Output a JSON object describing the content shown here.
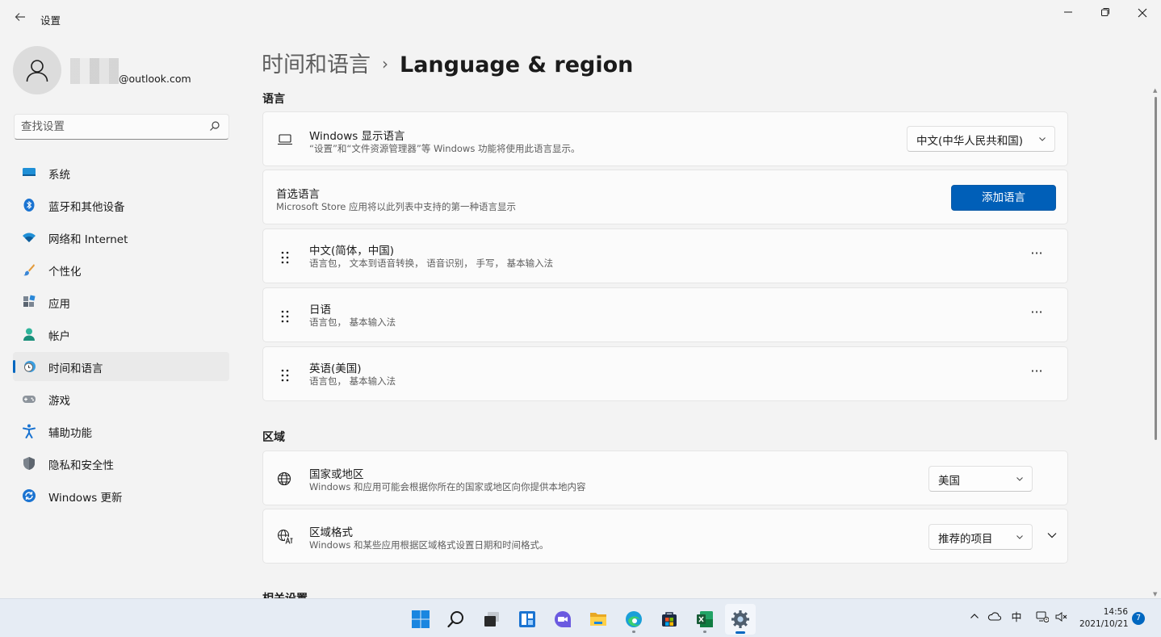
{
  "window": {
    "app_title": "设置"
  },
  "user": {
    "email_suffix": "@outlook.com"
  },
  "search": {
    "placeholder": "查找设置"
  },
  "nav": {
    "items": [
      {
        "label": "系统",
        "icon": "system-icon"
      },
      {
        "label": "蓝牙和其他设备",
        "icon": "bluetooth-icon"
      },
      {
        "label": "网络和 Internet",
        "icon": "wifi-icon"
      },
      {
        "label": "个性化",
        "icon": "brush-icon"
      },
      {
        "label": "应用",
        "icon": "apps-icon"
      },
      {
        "label": "帐户",
        "icon": "account-icon"
      },
      {
        "label": "时间和语言",
        "icon": "time-language-icon",
        "selected": true
      },
      {
        "label": "游戏",
        "icon": "gamepad-icon"
      },
      {
        "label": "辅助功能",
        "icon": "accessibility-icon"
      },
      {
        "label": "隐私和安全性",
        "icon": "shield-icon"
      },
      {
        "label": "Windows 更新",
        "icon": "update-icon"
      }
    ]
  },
  "breadcrumb": {
    "parent": "时间和语言",
    "separator": "›",
    "current": "Language & region"
  },
  "language_section": {
    "title": "语言",
    "display_language": {
      "title": "Windows 显示语言",
      "subtitle": "“设置”和“文件资源管理器”等 Windows 功能将使用此语言显示。",
      "value": "中文(中华人民共和国)"
    },
    "preferred": {
      "title": "首选语言",
      "subtitle": "Microsoft Store 应用将以此列表中支持的第一种语言显示",
      "button": "添加语言"
    },
    "languages": [
      {
        "name": "中文(简体，中国)",
        "features": "语言包， 文本到语音转换， 语音识别， 手写， 基本输入法"
      },
      {
        "name": "日语",
        "features": "语言包， 基本输入法"
      },
      {
        "name": "英语(美国)",
        "features": "语言包， 基本输入法"
      }
    ],
    "more_glyph": "···"
  },
  "region_section": {
    "title": "区域",
    "country": {
      "title": "国家或地区",
      "subtitle": "Windows 和应用可能会根据你所在的国家或地区向你提供本地内容",
      "value": "美国"
    },
    "format": {
      "title": "区域格式",
      "subtitle": "Windows 和某些应用根据区域格式设置日期和时间格式。",
      "value": "推荐的项目"
    }
  },
  "related_section": {
    "title": "相关设置"
  },
  "taskbar": {
    "apps": [
      "start-icon",
      "search-icon",
      "task-view-icon",
      "widgets-icon",
      "chat-icon",
      "file-explorer-icon",
      "edge-icon",
      "store-icon",
      "excel-icon",
      "settings-icon"
    ],
    "tray": {
      "ime": "中",
      "time": "14:56",
      "date": "2021/10/21",
      "notifications": "7"
    }
  },
  "colors": {
    "accent": "#005fb8",
    "background": "#f3f3f3",
    "card": "#fbfbfb",
    "taskbar": "#e6ecf4"
  }
}
